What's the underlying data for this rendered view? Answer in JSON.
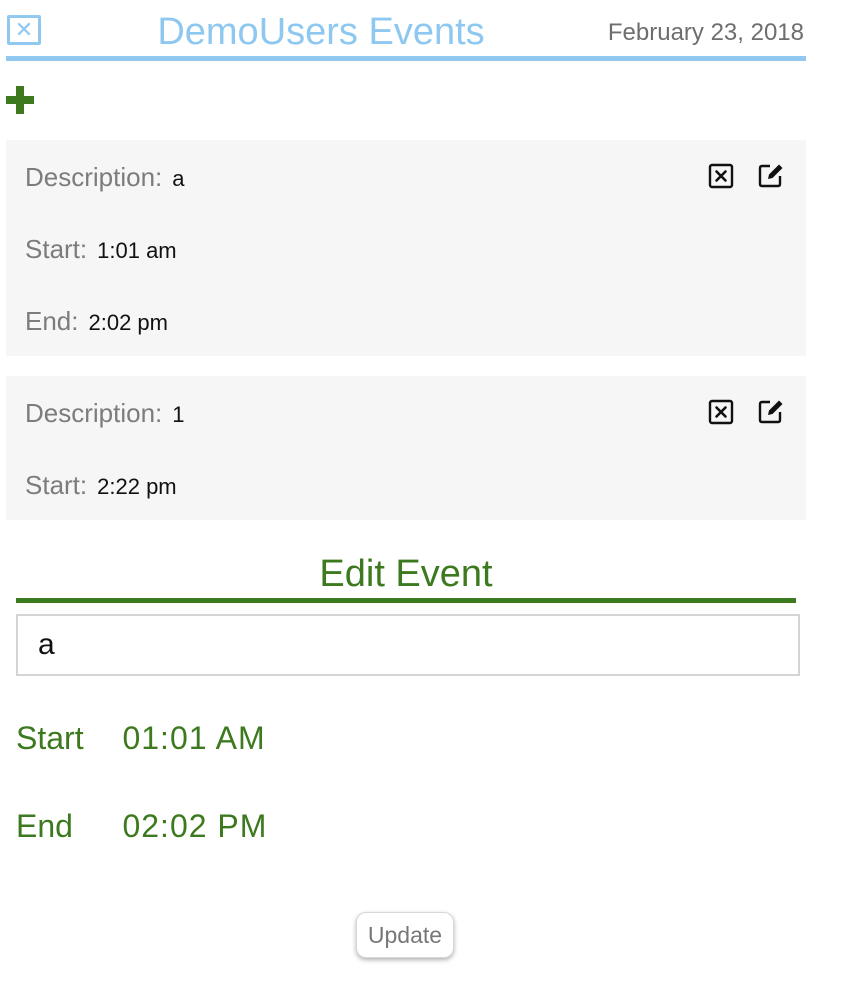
{
  "header": {
    "title": "DemoUsers Events",
    "date": "February 23, 2018",
    "close_glyph": "✕"
  },
  "colors": {
    "header_accent": "#90c8f0",
    "edit_accent": "#3d7a1f",
    "card_background": "#f6f6f6"
  },
  "events": [
    {
      "description_label": "Description:",
      "description": "a",
      "start_label": "Start:",
      "start": "1:01 am",
      "end_label": "End:",
      "end": "2:02 pm"
    },
    {
      "description_label": "Description:",
      "description": "1",
      "start_label": "Start:",
      "start": "2:22 pm"
    }
  ],
  "edit": {
    "title": "Edit Event",
    "description_value": "a",
    "start_label": "Start",
    "start_value": "01:01 AM",
    "end_label": "End",
    "end_value": "02:02 PM",
    "update_label": "Update"
  },
  "icons": {
    "close": "close-icon",
    "add": "plus-icon",
    "delete": "delete-icon",
    "edit": "edit-icon"
  }
}
